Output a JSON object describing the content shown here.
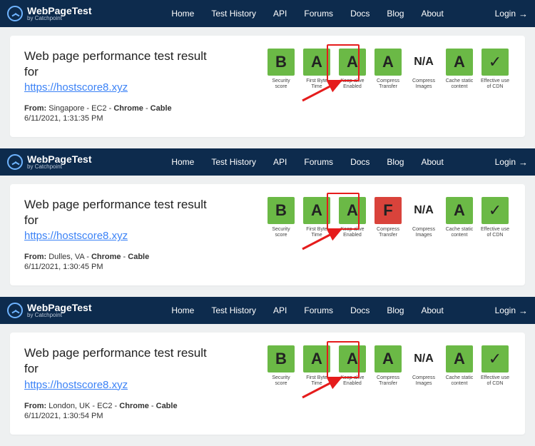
{
  "brand": {
    "title": "WebPageTest",
    "sub": "by Catchpoint"
  },
  "nav": [
    "Home",
    "Test History",
    "API",
    "Forums",
    "Docs",
    "Blog",
    "About"
  ],
  "login": "Login",
  "heading": "Web page performance test result for",
  "url": "https://hostscore8.xyz",
  "grade_labels": [
    "Security score",
    "First Byte Time",
    "Keep-alive Enabled",
    "Compress Transfer",
    "Compress Images",
    "Cache static content",
    "Effective use of CDN"
  ],
  "tests": [
    {
      "from_prefix": "From:",
      "from": " Singapore - EC2 - ",
      "bold2": "Chrome",
      "tail": " - ",
      "bold3": "Cable",
      "ts": "6/11/2021, 1:31:35 PM",
      "grades": [
        {
          "t": "B",
          "c": "g-green"
        },
        {
          "t": "A",
          "c": "g-green"
        },
        {
          "t": "A",
          "c": "g-green"
        },
        {
          "t": "A",
          "c": "g-green"
        },
        {
          "t": "N/A",
          "c": "g-na"
        },
        {
          "t": "A",
          "c": "g-green"
        },
        {
          "t": "",
          "c": "g-check"
        }
      ]
    },
    {
      "from_prefix": "From:",
      "from": " Dulles, VA - ",
      "bold2": "Chrome",
      "tail": " - ",
      "bold3": "Cable",
      "ts": "6/11/2021, 1:30:45 PM",
      "grades": [
        {
          "t": "B",
          "c": "g-green"
        },
        {
          "t": "A",
          "c": "g-green"
        },
        {
          "t": "A",
          "c": "g-green"
        },
        {
          "t": "F",
          "c": "g-red"
        },
        {
          "t": "N/A",
          "c": "g-na"
        },
        {
          "t": "A",
          "c": "g-green"
        },
        {
          "t": "",
          "c": "g-check"
        }
      ]
    },
    {
      "from_prefix": "From:",
      "from": " London, UK - EC2 - ",
      "bold2": "Chrome",
      "tail": " - ",
      "bold3": "Cable",
      "ts": "6/11/2021, 1:30:54 PM",
      "grades": [
        {
          "t": "B",
          "c": "g-green"
        },
        {
          "t": "A",
          "c": "g-green"
        },
        {
          "t": "A",
          "c": "g-green"
        },
        {
          "t": "A",
          "c": "g-green"
        },
        {
          "t": "N/A",
          "c": "g-na"
        },
        {
          "t": "A",
          "c": "g-green"
        },
        {
          "t": "",
          "c": "g-check"
        }
      ]
    }
  ]
}
